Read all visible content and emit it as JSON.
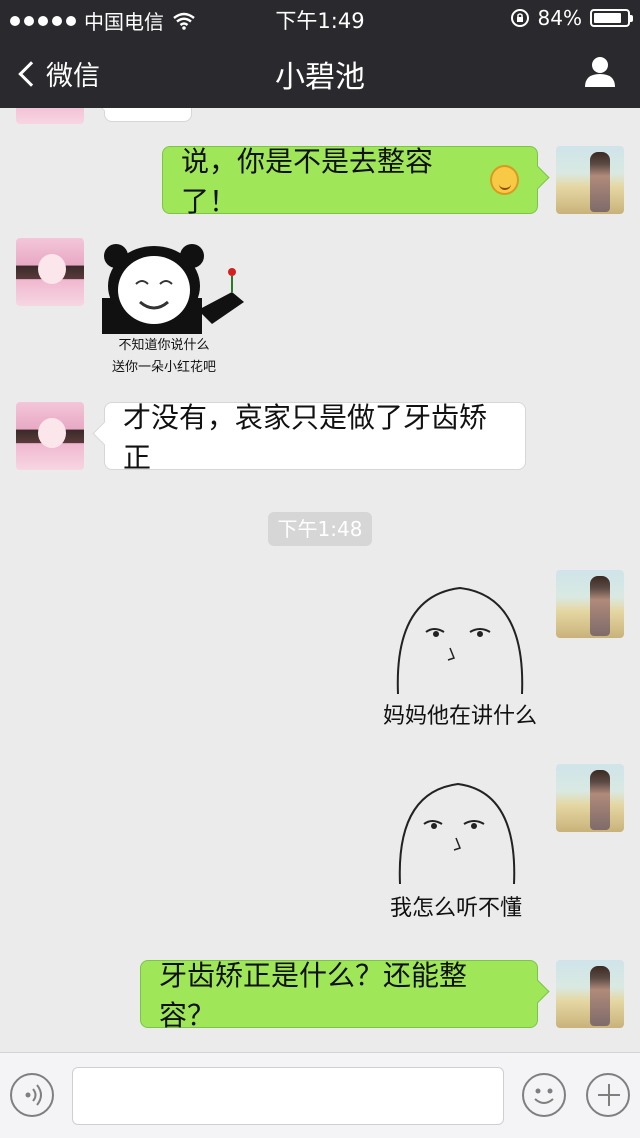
{
  "status_bar": {
    "carrier": "中国电信",
    "time": "下午1:49",
    "battery": "84%",
    "battery_level": 0.84
  },
  "nav": {
    "back_label": "微信",
    "title": "小碧池"
  },
  "messages": [
    {
      "sender": "me",
      "text": "说，你是不是去整容了！"
    },
    {
      "sender": "other",
      "sticker_caption_1": "不知道你说什么",
      "sticker_caption_2": "送你一朵小红花吧"
    },
    {
      "sender": "other",
      "text": "才没有，哀家只是做了牙齿矫正"
    },
    {
      "timestamp": "下午1:48"
    },
    {
      "sender": "me",
      "sticker_caption": "妈妈他在讲什么"
    },
    {
      "sender": "me",
      "sticker_caption": "我怎么听不懂"
    },
    {
      "sender": "me",
      "text": "牙齿矫正是什么？还能整容？"
    }
  ],
  "icons": {
    "signal": "signal-dots-icon",
    "wifi": "wifi-icon",
    "lock": "orientation-lock-icon",
    "battery": "battery-icon",
    "back": "chevron-left-icon",
    "profile": "person-icon",
    "voice": "voice-icon",
    "emoji": "emoji-icon",
    "more": "plus-icon"
  },
  "colors": {
    "nav_bg": "#2a2a2e",
    "chat_bg": "#ebebeb",
    "bubble_green": "#9fe759",
    "bubble_white": "#ffffff"
  }
}
